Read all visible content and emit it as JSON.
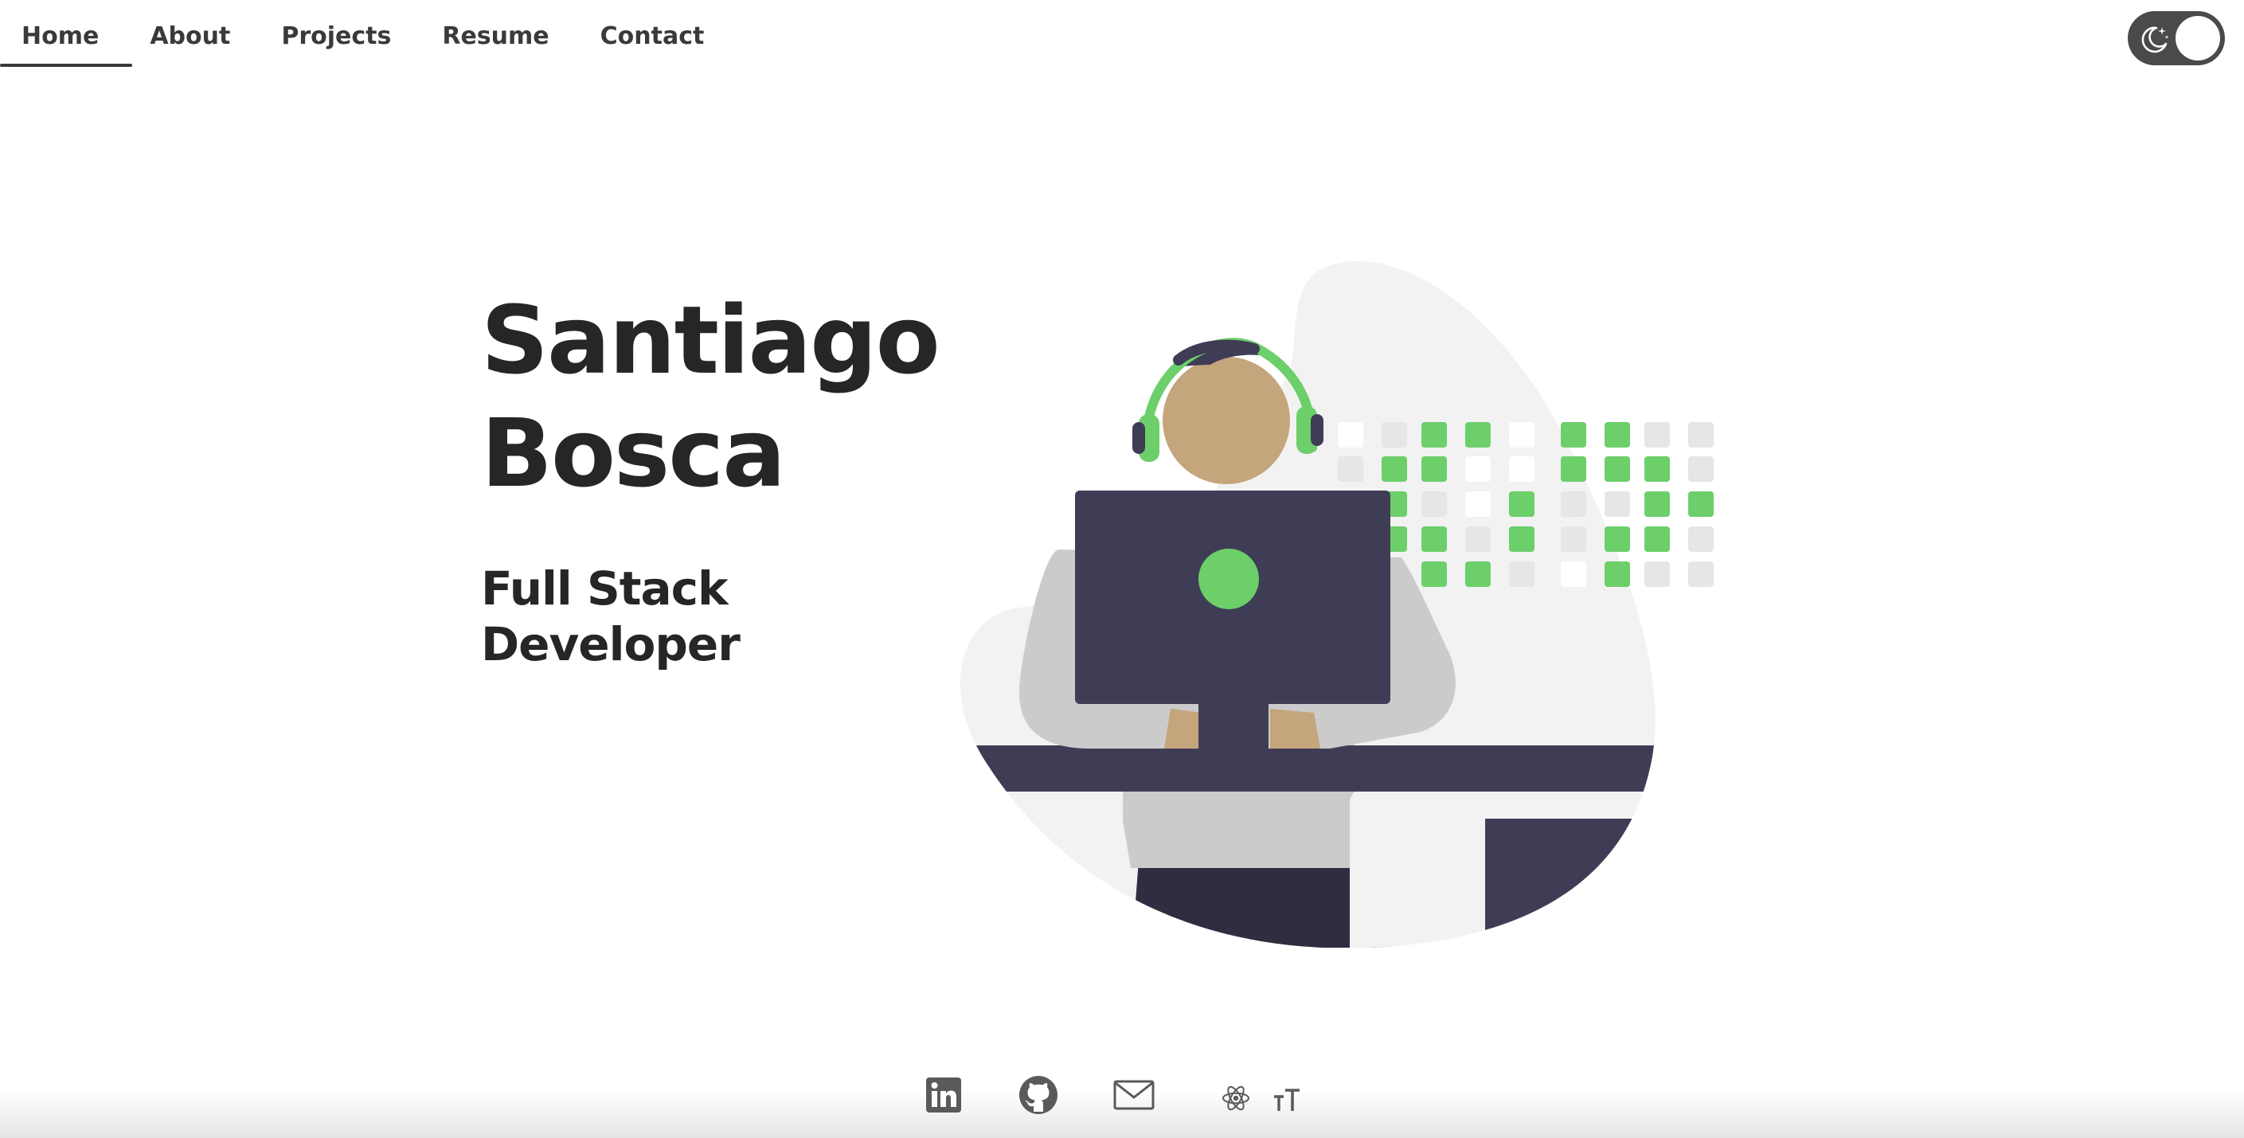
{
  "nav": {
    "items": [
      {
        "label": "Home",
        "active": true
      },
      {
        "label": "About",
        "active": false
      },
      {
        "label": "Projects",
        "active": false
      },
      {
        "label": "Resume",
        "active": false
      },
      {
        "label": "Contact",
        "active": false
      }
    ]
  },
  "theme_toggle": {
    "icon": "moon-stars-icon",
    "state": "light"
  },
  "hero": {
    "name_line1": "Santiago",
    "name_line2": "Bosca",
    "role_line1": "Full Stack",
    "role_line2": "Developer",
    "illustration": "developer-at-desk-illustration"
  },
  "footer": {
    "icons": [
      "linkedin-icon",
      "github-icon",
      "mail-icon",
      "react-icon",
      "font-size-icon"
    ]
  },
  "colors": {
    "text": "#262626",
    "accent_green": "#6ccf6a",
    "dark_navy": "#3f3d56",
    "blob_gray": "#f2f2f2",
    "skin": "#c4a57c"
  }
}
